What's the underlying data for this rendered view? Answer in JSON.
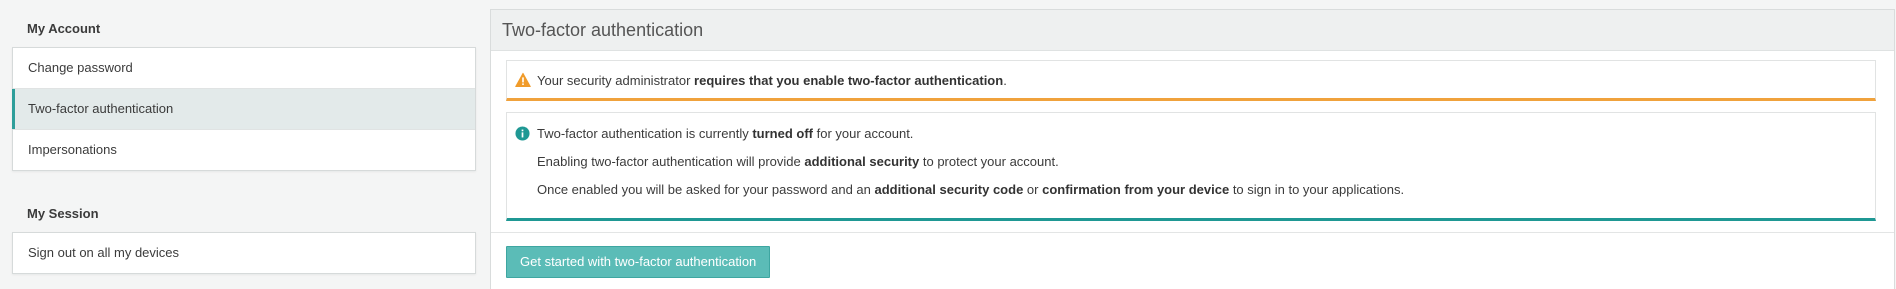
{
  "sidebar": {
    "account_title": "My Account",
    "account_items": [
      {
        "label": "Change password"
      },
      {
        "label": "Two-factor authentication"
      },
      {
        "label": "Impersonations"
      }
    ],
    "session_title": "My Session",
    "session_items": [
      {
        "label": "Sign out on all my devices"
      }
    ]
  },
  "main": {
    "title": "Two-factor authentication",
    "warning": {
      "text_before": "Your security administrator ",
      "text_bold": "requires that you enable two-factor authentication",
      "text_after": "."
    },
    "info": {
      "line1_before": "Two-factor authentication is currently ",
      "line1_bold": "turned off",
      "line1_after": " for your account.",
      "line2_before": "Enabling two-factor authentication will provide ",
      "line2_bold": "additional security",
      "line2_after": " to protect your account.",
      "line3_before": "Once enabled you will be asked for your password and an ",
      "line3_bold1": "additional security code",
      "line3_mid": " or ",
      "line3_bold2": "confirmation from your device",
      "line3_after": " to sign in to your applications."
    },
    "start_button_label": "Get started with two-factor authentication"
  },
  "colors": {
    "accent": "#2e9e9a",
    "warning": "#f0a23c",
    "info": "#1f9894",
    "button": "#5bbcb7"
  },
  "icons": {
    "warning": "warning-triangle-icon",
    "info": "info-circle-icon"
  }
}
